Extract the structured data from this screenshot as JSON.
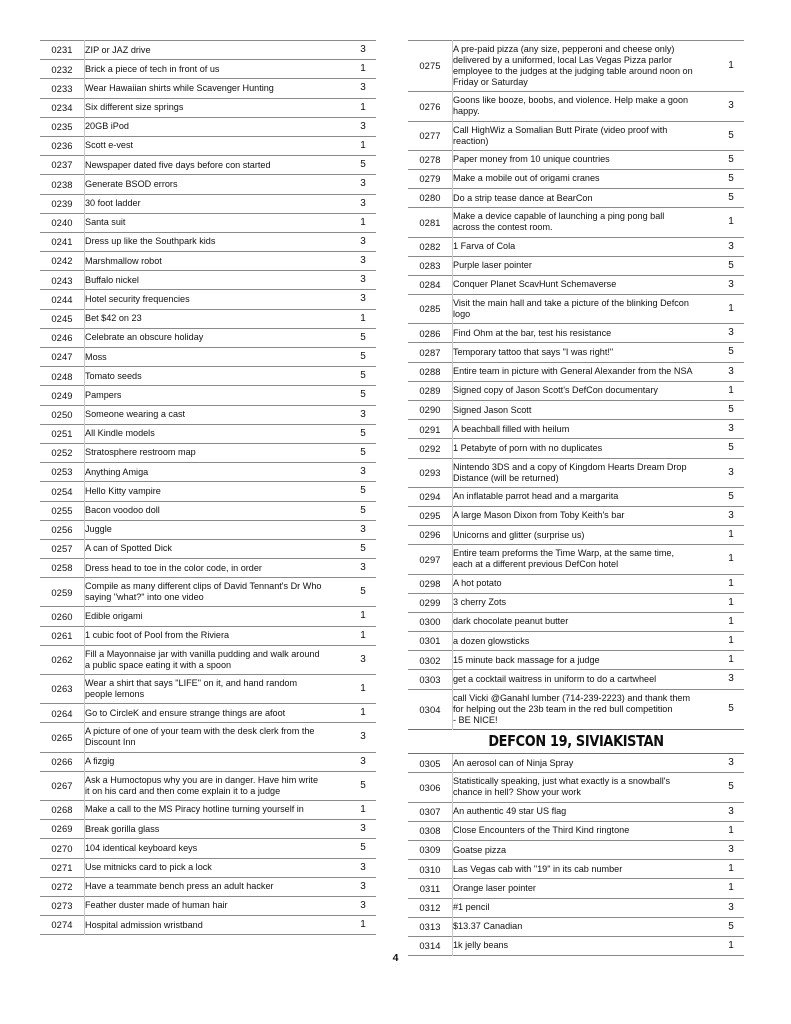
{
  "document": {
    "page_number": "4",
    "columns": [
      {
        "name": "left-column",
        "blocks": [
          {
            "type": "rows",
            "rows": [
              {
                "id": "0231",
                "desc": [
                  "ZIP or JAZ drive"
                ],
                "points": "3"
              },
              {
                "id": "0232",
                "desc": [
                  "Brick a piece of tech in front of us"
                ],
                "points": "1"
              },
              {
                "id": "0233",
                "desc": [
                  "Wear Hawaiian shirts while Scavenger Hunting"
                ],
                "points": "3"
              },
              {
                "id": "0234",
                "desc": [
                  "Six different size springs"
                ],
                "points": "1"
              },
              {
                "id": "0235",
                "desc": [
                  "20GB iPod"
                ],
                "points": "3"
              },
              {
                "id": "0236",
                "desc": [
                  "Scott e-vest"
                ],
                "points": "1"
              },
              {
                "id": "0237",
                "desc": [
                  "Newspaper dated five days before con started"
                ],
                "points": "5"
              },
              {
                "id": "0238",
                "desc": [
                  "Generate BSOD errors"
                ],
                "points": "3"
              },
              {
                "id": "0239",
                "desc": [
                  "30 foot ladder"
                ],
                "points": "3"
              },
              {
                "id": "0240",
                "desc": [
                  "Santa suit"
                ],
                "points": "1"
              },
              {
                "id": "0241",
                "desc": [
                  "Dress up like the Southpark kids"
                ],
                "points": "3"
              },
              {
                "id": "0242",
                "desc": [
                  "Marshmallow robot"
                ],
                "points": "3"
              },
              {
                "id": "0243",
                "desc": [
                  "Buffalo nickel"
                ],
                "points": "3"
              },
              {
                "id": "0244",
                "desc": [
                  "Hotel security frequencies"
                ],
                "points": "3"
              },
              {
                "id": "0245",
                "desc": [
                  "Bet $42 on 23"
                ],
                "points": "1"
              },
              {
                "id": "0246",
                "desc": [
                  "Celebrate an obscure holiday"
                ],
                "points": "5"
              },
              {
                "id": "0247",
                "desc": [
                  "Moss"
                ],
                "points": "5"
              },
              {
                "id": "0248",
                "desc": [
                  "Tomato seeds"
                ],
                "points": "5"
              },
              {
                "id": "0249",
                "desc": [
                  "Pampers"
                ],
                "points": "5"
              },
              {
                "id": "0250",
                "desc": [
                  "Someone wearing a cast"
                ],
                "points": "3"
              },
              {
                "id": "0251",
                "desc": [
                  "All Kindle models"
                ],
                "points": "5"
              },
              {
                "id": "0252",
                "desc": [
                  "Stratosphere restroom map"
                ],
                "points": "5"
              },
              {
                "id": "0253",
                "desc": [
                  "Anything Amiga"
                ],
                "points": "3"
              },
              {
                "id": "0254",
                "desc": [
                  "Hello Kitty vampire"
                ],
                "points": "5"
              },
              {
                "id": "0255",
                "desc": [
                  "Bacon voodoo doll"
                ],
                "points": "5"
              },
              {
                "id": "0256",
                "desc": [
                  "Juggle"
                ],
                "points": "3"
              },
              {
                "id": "0257",
                "desc": [
                  "A can of Spotted Dick"
                ],
                "points": "5"
              },
              {
                "id": "0258",
                "desc": [
                  "Dress head to toe in the color code, in order"
                ],
                "points": "3"
              },
              {
                "id": "0259",
                "desc": [
                  "Compile as many different clips of David Tennant's Dr Who",
                  "saying \"what?\" into one video"
                ],
                "points": "5"
              },
              {
                "id": "0260",
                "desc": [
                  "Edible origami"
                ],
                "points": "1"
              },
              {
                "id": "0261",
                "desc": [
                  "1 cubic foot of Pool from the Riviera"
                ],
                "points": "1"
              },
              {
                "id": "0262",
                "desc": [
                  "Fill a Mayonnaise jar with vanilla pudding and walk around",
                  "a public space eating it with a spoon"
                ],
                "points": "3"
              },
              {
                "id": "0263",
                "desc": [
                  "Wear a shirt that says \"LIFE\" on it, and hand random",
                  "people lemons"
                ],
                "points": "1"
              },
              {
                "id": "0264",
                "desc": [
                  "Go to CircleK and ensure strange things are afoot"
                ],
                "points": "1"
              },
              {
                "id": "0265",
                "desc": [
                  "A picture of one of your team with the desk clerk from the",
                  "Discount Inn"
                ],
                "points": "3"
              },
              {
                "id": "0266",
                "desc": [
                  "A fizgig"
                ],
                "points": "3"
              },
              {
                "id": "0267",
                "desc": [
                  "Ask a Humoctopus why you are in danger. Have him write",
                  "it on his card and then come explain it to a judge"
                ],
                "points": "5"
              },
              {
                "id": "0268",
                "desc": [
                  "Make a call to the MS Piracy hotline turning yourself in"
                ],
                "points": "1"
              },
              {
                "id": "0269",
                "desc": [
                  "Break gorilla glass"
                ],
                "points": "3"
              },
              {
                "id": "0270",
                "desc": [
                  "104 identical keyboard keys"
                ],
                "points": "5"
              },
              {
                "id": "0271",
                "desc": [
                  "Use mitnicks card to pick a lock"
                ],
                "points": "3"
              },
              {
                "id": "0272",
                "desc": [
                  "Have a teammate bench press an adult hacker"
                ],
                "points": "3"
              },
              {
                "id": "0273",
                "desc": [
                  "Feather duster made of human hair"
                ],
                "points": "3"
              },
              {
                "id": "0274",
                "desc": [
                  "Hospital admission wristband"
                ],
                "points": "1"
              }
            ]
          }
        ]
      },
      {
        "name": "right-column",
        "blocks": [
          {
            "type": "rows",
            "rows": [
              {
                "id": "0275",
                "desc": [
                  "A pre-paid pizza (any size, pepperoni and cheese only)",
                  "delivered by a uniformed, local Las Vegas Pizza parlor",
                  "employee to the judges at the judging table around noon on",
                  "Friday or Saturday"
                ],
                "points": "1"
              },
              {
                "id": "0276",
                "desc": [
                  "Goons like booze, boobs, and violence. Help make a goon",
                  "happy."
                ],
                "points": "3"
              },
              {
                "id": "0277",
                "desc": [
                  "Call HighWiz a Somalian Butt Pirate (video proof with",
                  "reaction)"
                ],
                "points": "5"
              },
              {
                "id": "0278",
                "desc": [
                  "Paper money from 10 unique countries"
                ],
                "points": "5"
              },
              {
                "id": "0279",
                "desc": [
                  "Make a mobile out of origami cranes"
                ],
                "points": "5"
              },
              {
                "id": "0280",
                "desc": [
                  "Do a strip tease dance at BearCon"
                ],
                "points": "5"
              },
              {
                "id": "0281",
                "desc": [
                  "Make a device capable of launching a ping pong ball",
                  "across the contest room."
                ],
                "points": "1"
              },
              {
                "id": "0282",
                "desc": [
                  "1 Farva of Cola"
                ],
                "points": "3"
              },
              {
                "id": "0283",
                "desc": [
                  "Purple laser pointer"
                ],
                "points": "5"
              },
              {
                "id": "0284",
                "desc": [
                  "Conquer Planet ScavHunt Schemaverse"
                ],
                "points": "3"
              },
              {
                "id": "0285",
                "desc": [
                  "Visit the main hall and take a picture of the blinking Defcon",
                  "logo"
                ],
                "points": "1"
              },
              {
                "id": "0286",
                "desc": [
                  "Find Ohm at the bar, test his resistance"
                ],
                "points": "3"
              },
              {
                "id": "0287",
                "desc": [
                  "Temporary tattoo that says \"I was right!\""
                ],
                "points": "5"
              },
              {
                "id": "0288",
                "desc": [
                  "Entire team in picture with General Alexander from the NSA"
                ],
                "points": "3"
              },
              {
                "id": "0289",
                "desc": [
                  "Signed copy of Jason Scott's DefCon documentary"
                ],
                "points": "1"
              },
              {
                "id": "0290",
                "desc": [
                  "Signed Jason Scott"
                ],
                "points": "5"
              },
              {
                "id": "0291",
                "desc": [
                  "A beachball filled with heilum"
                ],
                "points": "3"
              },
              {
                "id": "0292",
                "desc": [
                  "1 Petabyte of porn with no duplicates"
                ],
                "points": "5"
              },
              {
                "id": "0293",
                "desc": [
                  "Nintendo 3DS and a copy of Kingdom Hearts Dream Drop",
                  "Distance (will be returned)"
                ],
                "points": "3"
              },
              {
                "id": "0294",
                "desc": [
                  "An inflatable parrot head and a margarita"
                ],
                "points": "5"
              },
              {
                "id": "0295",
                "desc": [
                  "A large Mason Dixon from Toby Keith's bar"
                ],
                "points": "3"
              },
              {
                "id": "0296",
                "desc": [
                  "Unicorns and glitter (surprise us)"
                ],
                "points": "1"
              },
              {
                "id": "0297",
                "desc": [
                  "Entire team preforms the Time Warp, at the same time,",
                  "each at a different previous DefCon hotel"
                ],
                "points": "1"
              },
              {
                "id": "0298",
                "desc": [
                  "A hot potato"
                ],
                "points": "1"
              },
              {
                "id": "0299",
                "desc": [
                  "3 cherry Zots"
                ],
                "points": "1"
              },
              {
                "id": "0300",
                "desc": [
                  "dark chocolate peanut butter"
                ],
                "points": "1"
              },
              {
                "id": "0301",
                "desc": [
                  "a dozen glowsticks"
                ],
                "points": "1"
              },
              {
                "id": "0302",
                "desc": [
                  "15 minute back massage for a judge"
                ],
                "points": "1"
              },
              {
                "id": "0303",
                "desc": [
                  "get a cocktail waitress in uniform to do a cartwheel"
                ],
                "points": "3"
              },
              {
                "id": "0304",
                "desc": [
                  "call Vicki @Ganahl lumber (714-239-2223) and thank them",
                  "for helping out the 23b team in the red bull competition",
                  "-  BE NICE!"
                ],
                "points": "5"
              }
            ]
          },
          {
            "type": "section",
            "title": "DEFCON 19, SIVIAKISTAN"
          },
          {
            "type": "rows",
            "rows": [
              {
                "id": "0305",
                "desc": [
                  "An aerosol can of Ninja Spray"
                ],
                "points": "3"
              },
              {
                "id": "0306",
                "desc": [
                  "Statistically speaking, just what exactly is a snowball's",
                  "chance in hell?  Show your work"
                ],
                "points": "5"
              },
              {
                "id": "0307",
                "desc": [
                  "An authentic 49 star US flag"
                ],
                "points": "3"
              },
              {
                "id": "0308",
                "desc": [
                  "Close Encounters of the Third Kind ringtone"
                ],
                "points": "1"
              },
              {
                "id": "0309",
                "desc": [
                  "Goatse pizza"
                ],
                "points": "3"
              },
              {
                "id": "0310",
                "desc": [
                  "Las Vegas cab with \"19\" in its cab number"
                ],
                "points": "1"
              },
              {
                "id": "0311",
                "desc": [
                  "Orange laser pointer"
                ],
                "points": "1"
              },
              {
                "id": "0312",
                "desc": [
                  "#1 pencil"
                ],
                "points": "3"
              },
              {
                "id": "0313",
                "desc": [
                  "$13.37 Canadian"
                ],
                "points": "5"
              },
              {
                "id": "0314",
                "desc": [
                  "1k jelly beans"
                ],
                "points": "1"
              }
            ]
          }
        ]
      }
    ]
  }
}
